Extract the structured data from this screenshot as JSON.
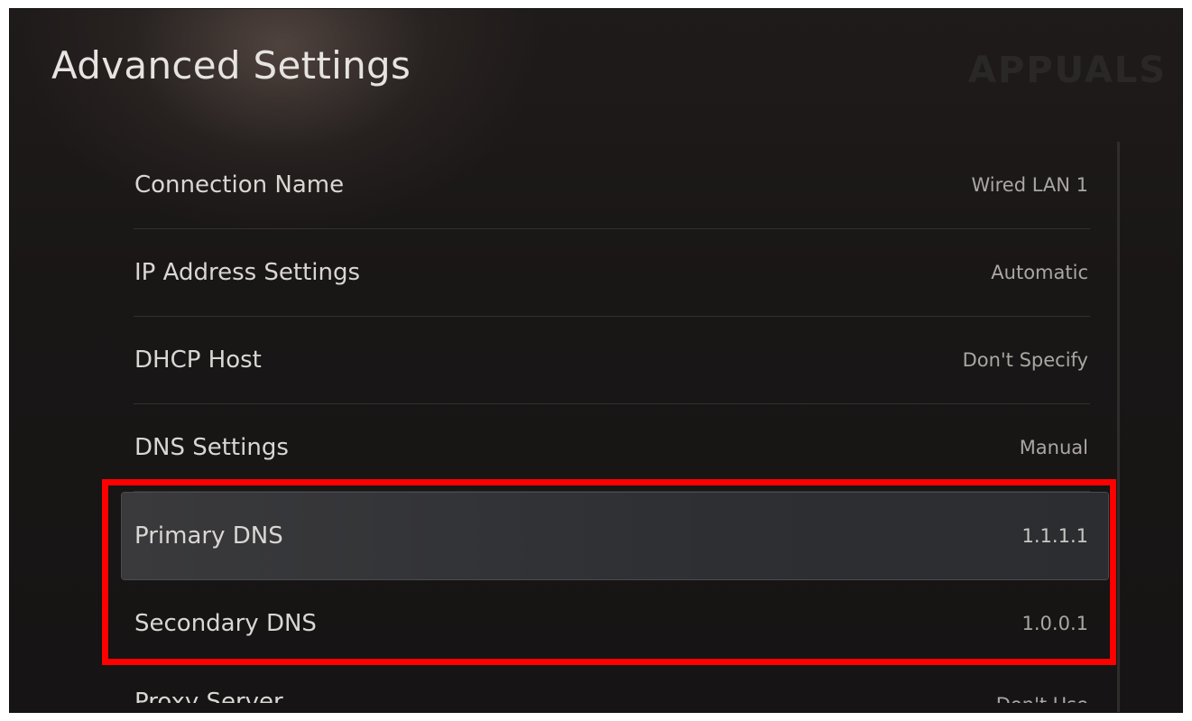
{
  "header": {
    "title": "Advanced Settings",
    "watermark": "APPUALS"
  },
  "settings": [
    {
      "label": "Connection Name",
      "value": "Wired LAN 1"
    },
    {
      "label": "IP Address Settings",
      "value": "Automatic"
    },
    {
      "label": "DHCP Host",
      "value": "Don't Specify"
    },
    {
      "label": "DNS Settings",
      "value": "Manual"
    },
    {
      "label": "Primary DNS",
      "value": "1.1.1.1"
    },
    {
      "label": "Secondary DNS",
      "value": "1.0.0.1"
    },
    {
      "label": "Proxy Server",
      "value": "Don't Use"
    }
  ],
  "focused_item": "Primary DNS",
  "annotation": {
    "color": "#ff0000"
  },
  "colors": {
    "background": "#1a1717",
    "focus_background": "#2e3034"
  }
}
